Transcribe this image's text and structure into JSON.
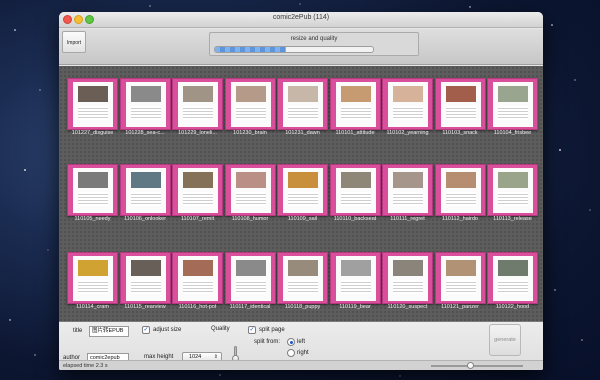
{
  "window": {
    "title": "comic2ePub  (114)"
  },
  "toolbar": {
    "import_label": "Import",
    "progress_label": "resize and quality",
    "progress_fraction": 0.45
  },
  "thumbnails": [
    {
      "label": "101227_disguise",
      "color": "#6b5e55"
    },
    {
      "label": "101228_sea-c...",
      "color": "#8a8a8a"
    },
    {
      "label": "101229_loneli...",
      "color": "#a09486"
    },
    {
      "label": "101230_brain",
      "color": "#b59a8a"
    },
    {
      "label": "101231_dawn",
      "color": "#c7b7a8"
    },
    {
      "label": "110101_attitude",
      "color": "#c79b72"
    },
    {
      "label": "110102_yearning",
      "color": "#d6b29a"
    },
    {
      "label": "110103_snack",
      "color": "#a25e4a"
    },
    {
      "label": "110104_frisbee",
      "color": "#9aa58f"
    },
    {
      "label": "110105_needy",
      "color": "#7a7a7a"
    },
    {
      "label": "110106_onlooker",
      "color": "#5f7884"
    },
    {
      "label": "110107_remit",
      "color": "#857058"
    },
    {
      "label": "110108_humor",
      "color": "#b98f86"
    },
    {
      "label": "110109_sail",
      "color": "#c8903d"
    },
    {
      "label": "110110_backseat",
      "color": "#8e8778"
    },
    {
      "label": "110111_regret",
      "color": "#a5958a"
    },
    {
      "label": "110112_hairdo",
      "color": "#b78d72"
    },
    {
      "label": "110113_release",
      "color": "#99a48b"
    },
    {
      "label": "110114_cram",
      "color": "#d0a232"
    },
    {
      "label": "110115_rearview",
      "color": "#675f58"
    },
    {
      "label": "110116_hot-pot",
      "color": "#a46b57"
    },
    {
      "label": "110117_identical",
      "color": "#8a8a8a"
    },
    {
      "label": "110118_puppy",
      "color": "#978b7c"
    },
    {
      "label": "110119_bear",
      "color": "#a0a0a0"
    },
    {
      "label": "110120_suspect",
      "color": "#8b847a"
    },
    {
      "label": "110121_panzer",
      "color": "#b29274"
    },
    {
      "label": "110122_hood",
      "color": "#6f7b6d"
    }
  ],
  "form": {
    "title_label": "title",
    "title_value": "图片转EPUB",
    "author_label": "author",
    "author_value": "comic2epub",
    "adjust_size_label": "adjust size",
    "adjust_size_checked": true,
    "quality_label": "Quality",
    "max_height_label": "max height",
    "max_height_value": "1024",
    "split_page_label": "split page",
    "split_page_checked": true,
    "split_from_label": "split from:",
    "split_left_label": "left",
    "split_right_label": "right",
    "split_selected": "left",
    "generate_label": "generate"
  },
  "status": {
    "elapsed": "elapsed time 2.3 s"
  },
  "icons": {
    "close": "close-button-icon",
    "minimize": "minimize-button-icon",
    "zoom": "zoom-button-icon",
    "checkmark": "checkmark-icon",
    "dropdown": "chevron-updown-icon"
  }
}
